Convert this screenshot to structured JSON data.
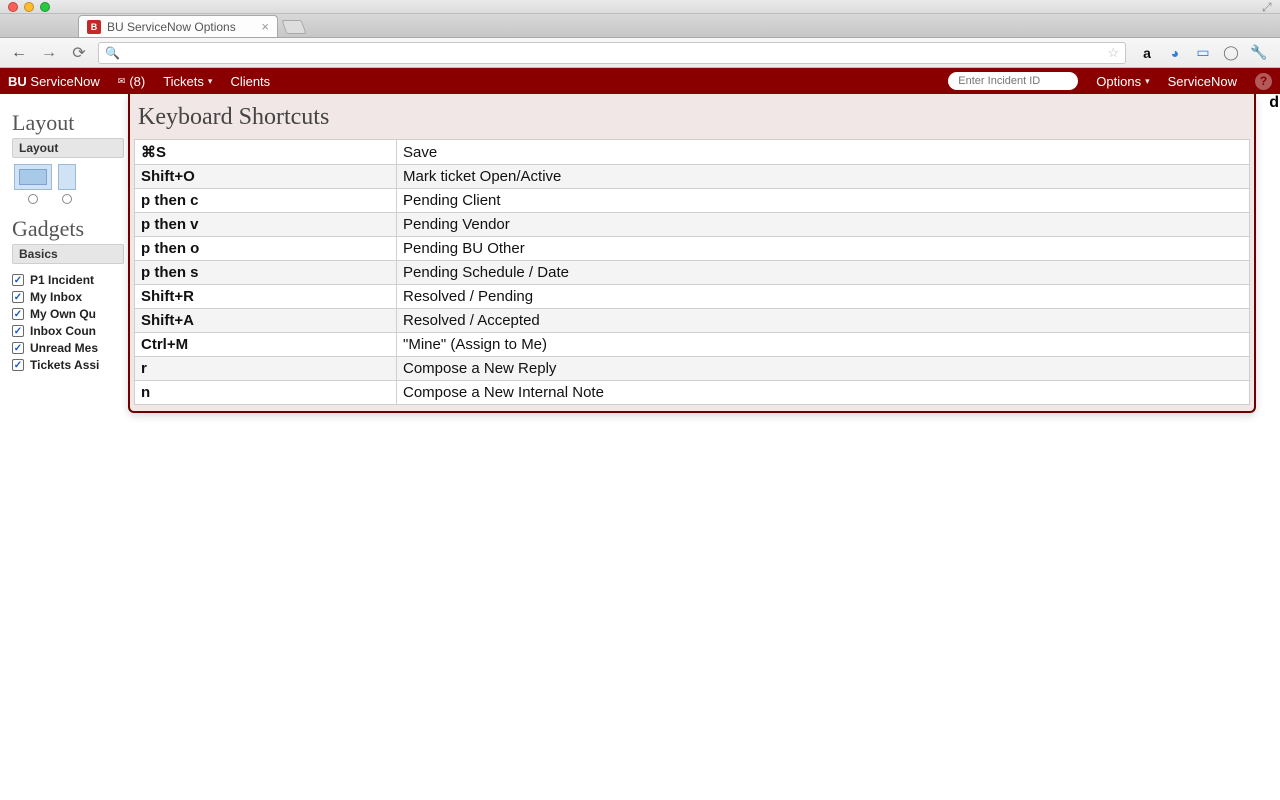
{
  "browser": {
    "tab_title": "BU ServiceNow Options"
  },
  "menubar": {
    "brand_bold": "BU",
    "brand_rest": "ServiceNow",
    "inbox_label": "(8)",
    "tickets": "Tickets",
    "clients": "Clients",
    "incident_placeholder": "Enter Incident ID",
    "options": "Options",
    "servicenow": "ServiceNow"
  },
  "sidebar": {
    "layout_title": "Layout",
    "layout_sub": "Layout",
    "gadgets_title": "Gadgets",
    "gadgets_sub": "Basics",
    "checks": [
      "P1 Incident",
      "My Inbox",
      "My Own Qu",
      "Inbox Coun",
      "Unread Mes",
      "Tickets Assi"
    ]
  },
  "modal": {
    "title": "Keyboard Shortcuts",
    "rows": [
      {
        "key": "⌘S",
        "desc": "Save"
      },
      {
        "key": "Shift+O",
        "desc": "Mark ticket Open/Active"
      },
      {
        "key": "p then c",
        "desc": "Pending Client"
      },
      {
        "key": "p then v",
        "desc": "Pending Vendor"
      },
      {
        "key": "p then o",
        "desc": "Pending BU Other"
      },
      {
        "key": "p then s",
        "desc": "Pending Schedule / Date"
      },
      {
        "key": "Shift+R",
        "desc": "Resolved / Pending"
      },
      {
        "key": "Shift+A",
        "desc": "Resolved / Accepted"
      },
      {
        "key": "Ctrl+M",
        "desc": "\"Mine\" (Assign to Me)"
      },
      {
        "key": "r",
        "desc": "Compose a New Reply"
      },
      {
        "key": "n",
        "desc": "Compose a New Internal Note"
      }
    ]
  },
  "bg_char": "d"
}
